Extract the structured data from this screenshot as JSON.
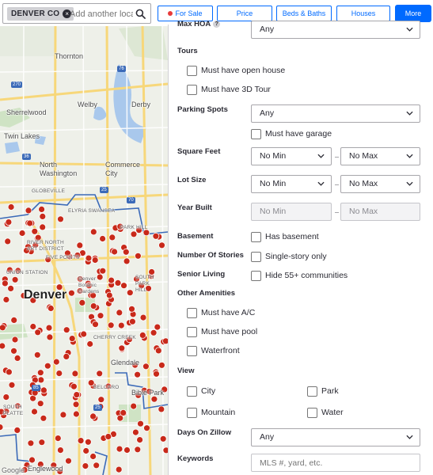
{
  "search": {
    "chip_label": "DENVER CO",
    "chip_remove_icon": "close-icon",
    "placeholder": "Add another location",
    "search_icon": "search-icon"
  },
  "filters": {
    "for_sale": "For Sale",
    "price": "Price",
    "beds_baths": "Beds & Baths",
    "home_type": "Houses",
    "more": "More"
  },
  "colors": {
    "accent": "#006aff",
    "listing_dot": "#c8291a",
    "for_sale_dot": "#e83a3a"
  },
  "map": {
    "labels": {
      "thornton": "Thornton",
      "welby": "Welby",
      "derby": "Derby",
      "sherrelwood": "Sherrelwood",
      "twin_lakes": "Twin Lakes",
      "north_washington": "North\nWashington",
      "commerce_city": "Commerce\nCity",
      "globeville": "GLOBEVILLE",
      "elyria": "ELYRIA SWANSEA",
      "park_hill": "PARK HILL",
      "river_north": "RIVER NORTH\nART DISTRICT",
      "five_points": "FIVE POINTS",
      "union_station": "UNION STATION",
      "denver": "Denver",
      "botanic": "Denver\nBotanic\nGardens",
      "south_park_hill": "SOUTH\nPARK\nHILL",
      "cherry_creek": "CHERRY CREEK",
      "glendale": "Glendale",
      "belcaro": "BELCARO",
      "bible_park": "Bible Park",
      "south_platte": "SOUTH\nPLATTE",
      "englewood": "Englewood",
      "google": "Google"
    },
    "shields": {
      "i270": "270",
      "i36": "36",
      "i76": "76",
      "i25a": "25",
      "i25b": "25",
      "i70": "70",
      "r85": "85"
    }
  },
  "panel": {
    "max_hoa": {
      "label": "Max HOA",
      "help_icon": "?",
      "value": "Any"
    },
    "tours": {
      "label": "Tours",
      "open_house": "Must have open house",
      "tour_3d": "Must have 3D Tour"
    },
    "parking": {
      "label": "Parking Spots",
      "value": "Any",
      "garage": "Must have garage"
    },
    "sqft": {
      "label": "Square Feet",
      "min": "No Min",
      "max": "No Max"
    },
    "lot": {
      "label": "Lot Size",
      "min": "No Min",
      "max": "No Max"
    },
    "year": {
      "label": "Year Built",
      "min": "No Min",
      "max": "No Max"
    },
    "basement": {
      "label": "Basement",
      "option": "Has basement"
    },
    "stories": {
      "label": "Number Of Stories",
      "option": "Single-story only"
    },
    "senior": {
      "label": "Senior Living",
      "option": "Hide 55+ communities"
    },
    "amenities": {
      "label": "Other Amenities",
      "ac": "Must have A/C",
      "pool": "Must have pool",
      "waterfront": "Waterfront"
    },
    "view": {
      "label": "View",
      "city": "City",
      "park": "Park",
      "mountain": "Mountain",
      "water": "Water"
    },
    "days": {
      "label": "Days On Zillow",
      "value": "Any"
    },
    "keywords": {
      "label": "Keywords",
      "placeholder": "MLS #, yard, etc."
    }
  }
}
